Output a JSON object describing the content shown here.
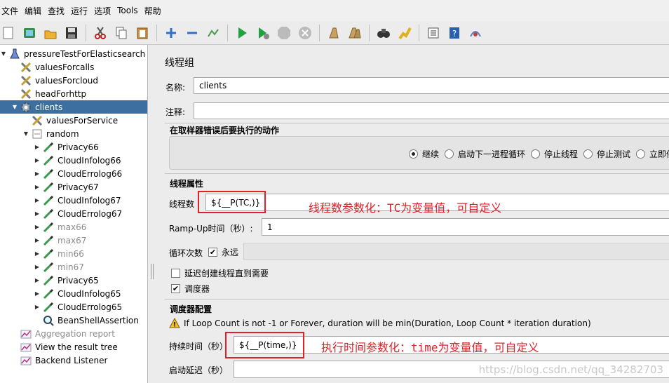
{
  "menu": [
    "文件",
    "编辑",
    "查找",
    "运行",
    "选项",
    "Tools",
    "帮助"
  ],
  "toolbar": [
    "new-icon",
    "templates-icon",
    "open-icon",
    "save-icon",
    "cut-icon",
    "copy-icon",
    "paste-icon",
    "expand-icon",
    "collapse-icon",
    "toggle-icon",
    "start-icon",
    "start-no-pause-icon",
    "stop-icon",
    "shutdown-icon",
    "clear-icon",
    "clear-all-icon",
    "search-icon",
    "reset-search-icon",
    "function-helper-icon",
    "help-icon",
    "remote-icon"
  ],
  "tree": [
    {
      "label": "pressureTestForElasticsearch",
      "icon": "flask-icon",
      "indent": 0,
      "arrow": "▼",
      "state": "normal"
    },
    {
      "label": "valuesForcalls",
      "icon": "config-tools-icon",
      "indent": 1,
      "arrow": "",
      "state": "normal"
    },
    {
      "label": "valuesForcloud",
      "icon": "config-tools-icon",
      "indent": 1,
      "arrow": "",
      "state": "normal"
    },
    {
      "label": "headForhttp",
      "icon": "config-tools-icon",
      "indent": 1,
      "arrow": "",
      "state": "normal"
    },
    {
      "label": "clients",
      "icon": "gear-icon",
      "indent": 1,
      "arrow": "▼",
      "state": "selected"
    },
    {
      "label": "valuesForService",
      "icon": "config-tools-icon",
      "indent": 2,
      "arrow": "",
      "state": "normal"
    },
    {
      "label": "random",
      "icon": "controller-icon",
      "indent": 2,
      "arrow": "▼",
      "state": "normal"
    },
    {
      "label": "Privacy66",
      "icon": "pipette-icon",
      "indent": 3,
      "arrow": "▶",
      "state": "normal"
    },
    {
      "label": "CloudInfolog66",
      "icon": "pipette-icon",
      "indent": 3,
      "arrow": "▶",
      "state": "normal"
    },
    {
      "label": "CloudErrolog66",
      "icon": "pipette-icon",
      "indent": 3,
      "arrow": "▶",
      "state": "normal"
    },
    {
      "label": "Privacy67",
      "icon": "pipette-icon",
      "indent": 3,
      "arrow": "▶",
      "state": "normal"
    },
    {
      "label": "CloudInfolog67",
      "icon": "pipette-icon",
      "indent": 3,
      "arrow": "▶",
      "state": "normal"
    },
    {
      "label": "CloudErrolog67",
      "icon": "pipette-icon",
      "indent": 3,
      "arrow": "▶",
      "state": "normal"
    },
    {
      "label": "max66",
      "icon": "pipette-icon",
      "indent": 3,
      "arrow": "▶",
      "state": "disabled"
    },
    {
      "label": "max67",
      "icon": "pipette-icon",
      "indent": 3,
      "arrow": "▶",
      "state": "disabled"
    },
    {
      "label": "min66",
      "icon": "pipette-icon",
      "indent": 3,
      "arrow": "▶",
      "state": "disabled"
    },
    {
      "label": "min67",
      "icon": "pipette-icon",
      "indent": 3,
      "arrow": "▶",
      "state": "disabled"
    },
    {
      "label": "Privacy65",
      "icon": "pipette-icon",
      "indent": 3,
      "arrow": "▶",
      "state": "normal"
    },
    {
      "label": "CloudInfolog65",
      "icon": "pipette-icon",
      "indent": 3,
      "arrow": "▶",
      "state": "normal"
    },
    {
      "label": "CloudErrolog65",
      "icon": "pipette-icon",
      "indent": 3,
      "arrow": "▶",
      "state": "normal"
    },
    {
      "label": "BeanShellAssertion",
      "icon": "magnifier-icon",
      "indent": 3,
      "arrow": "",
      "state": "normal"
    },
    {
      "label": "Aggregation report",
      "icon": "chart-icon",
      "indent": 1,
      "arrow": "",
      "state": "disabled"
    },
    {
      "label": "View the result tree",
      "icon": "chart-icon",
      "indent": 1,
      "arrow": "",
      "state": "normal"
    },
    {
      "label": "Backend Listener",
      "icon": "chart-icon",
      "indent": 1,
      "arrow": "",
      "state": "normal"
    }
  ],
  "panel": {
    "title": "线程组",
    "name_label": "名称:",
    "name_value": "clients",
    "comment_label": "注释:",
    "comment_value": "",
    "sampler_error_title": "在取样器错误后要执行的动作",
    "radios": [
      {
        "label": "继续",
        "checked": true
      },
      {
        "label": "启动下一进程循环",
        "checked": false
      },
      {
        "label": "停止线程",
        "checked": false
      },
      {
        "label": "停止测试",
        "checked": false
      },
      {
        "label": "立即停止测试",
        "checked": false
      }
    ],
    "thread_props_title": "线程属性",
    "threads_label": "线程数",
    "threads_value": "${__P(TC,)}",
    "threads_annotation": "线程数参数化：TC为变量值，可自定义",
    "rampup_label": "Ramp-Up时间（秒）:",
    "rampup_value": "1",
    "loop_label": "循环次数",
    "forever_label": "永远",
    "forever_checked": true,
    "delay_label": "延迟创建线程直到需要",
    "delay_checked": false,
    "scheduler_label": "调度器",
    "scheduler_checked": true,
    "scheduler_config_title": "调度器配置",
    "warning_text": "If Loop Count is not -1 or Forever, duration will be min(Duration, Loop Count * iteration duration)",
    "duration_label": "持续时间（秒）",
    "duration_value": "${__P(time,)}",
    "duration_annotation": "执行时间参数化：time为变量值，可自定义",
    "startup_delay_label": "启动延迟（秒）",
    "startup_delay_value": ""
  },
  "watermark": "https://blog.csdn.net/qq_34282703",
  "colors": {
    "selection": "#3d6fa0",
    "annotation_red": "#e0202a",
    "background": "#ececec"
  }
}
